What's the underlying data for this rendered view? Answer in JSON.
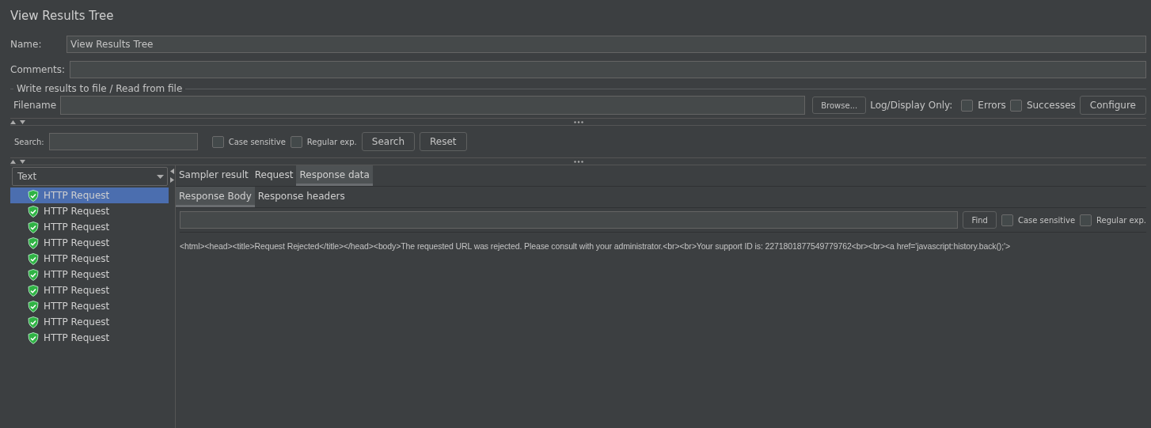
{
  "title": "View Results Tree",
  "name_field": {
    "label": "Name:",
    "value": "View Results Tree"
  },
  "comments_field": {
    "label": "Comments:"
  },
  "file_group": {
    "legend": "Write results to file / Read from file",
    "filename_label": "Filename",
    "browse_button": "Browse...",
    "log_label": "Log/Display Only:",
    "checkboxes": [
      {
        "label": "Errors",
        "checked": false
      },
      {
        "label": "Successes",
        "checked": false
      }
    ],
    "configure_button": "Configure"
  },
  "search_bar": {
    "label": "Search:",
    "checkboxes": [
      {
        "label": "Case sensitive",
        "checked": false
      },
      {
        "label": "Regular exp.",
        "checked": false
      }
    ],
    "buttons": [
      "Search",
      "Reset"
    ]
  },
  "renderer_select": {
    "value": "Text"
  },
  "results": [
    {
      "label": "HTTP Request",
      "selected": true
    },
    {
      "label": "HTTP Request",
      "selected": false
    },
    {
      "label": "HTTP Request",
      "selected": false
    },
    {
      "label": "HTTP Request",
      "selected": false
    },
    {
      "label": "HTTP Request",
      "selected": false
    },
    {
      "label": "HTTP Request",
      "selected": false
    },
    {
      "label": "HTTP Request",
      "selected": false
    },
    {
      "label": "HTTP Request",
      "selected": false
    },
    {
      "label": "HTTP Request",
      "selected": false
    },
    {
      "label": "HTTP Request",
      "selected": false
    }
  ],
  "tabs": [
    {
      "label": "Sampler result",
      "selected": false
    },
    {
      "label": "Request",
      "selected": false
    },
    {
      "label": "Response data",
      "selected": true
    }
  ],
  "subtabs": [
    {
      "label": "Response Body",
      "selected": true
    },
    {
      "label": "Response headers",
      "selected": false
    }
  ],
  "find_bar": {
    "button": "Find",
    "checkboxes": [
      {
        "label": "Case sensitive",
        "checked": false
      },
      {
        "label": "Regular exp.",
        "checked": false
      }
    ]
  },
  "response_body": "<html><head><title>Request Rejected</title></head><body>The requested URL was rejected. Please consult with your administrator.<br><br>Your support ID is: 2271801877549779762<br><br><a href='javascript:history.back();'>"
}
